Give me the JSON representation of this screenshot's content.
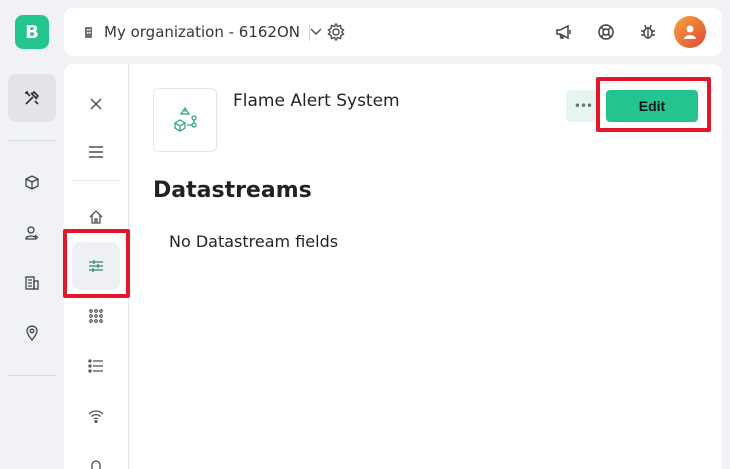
{
  "app": {
    "logo_letter": "B"
  },
  "rail": {
    "items": [
      {
        "name": "tools",
        "icon": "tools-icon",
        "active": true
      },
      {
        "name": "products",
        "icon": "cube-icon"
      },
      {
        "name": "users",
        "icon": "user-icon"
      },
      {
        "name": "organizations",
        "icon": "building-icon"
      },
      {
        "name": "locations",
        "icon": "location-pin-icon"
      }
    ]
  },
  "topbar": {
    "org_label": "My organization - 6162ON",
    "icons": [
      "megaphone-icon",
      "lifebuoy-icon",
      "bug-icon",
      "avatar"
    ]
  },
  "subnav": {
    "items": [
      "close-icon",
      "hamburger-icon",
      "home-icon",
      "datastreams-icon",
      "grid-icon",
      "list-icon",
      "wifi-icon",
      "bell-icon"
    ],
    "active": "datastreams-icon"
  },
  "main": {
    "title": "Flame Alert System",
    "more_label": "•••",
    "edit_label": "Edit",
    "section_title": "Datastreams",
    "empty_text": "No Datastream fields"
  },
  "colors": {
    "accent": "#23c48e",
    "highlight": "#e3162b"
  }
}
